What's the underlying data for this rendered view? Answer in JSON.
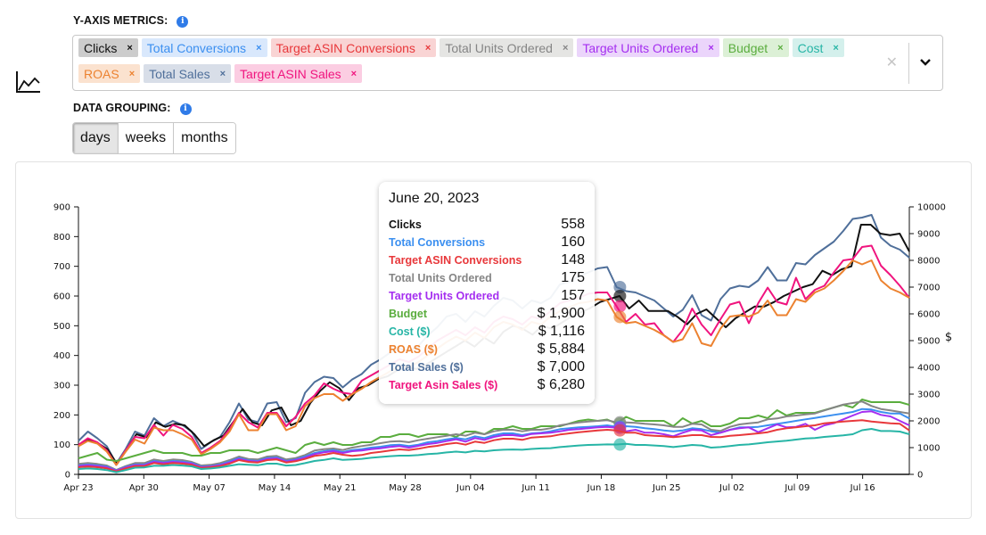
{
  "header": {
    "metrics_label": "Y-AXIS METRICS:",
    "grouping_label": "DATA GROUPING:",
    "info_icon": "i",
    "chart_type_icon": "line-chart-icon"
  },
  "metrics": [
    {
      "label": "Clicks",
      "color": "#111111",
      "bg": "#cccccc"
    },
    {
      "label": "Total Conversions",
      "color": "#3b8ff0",
      "bg": "#d9e8fc"
    },
    {
      "label": "Target ASIN Conversions",
      "color": "#e8383b",
      "bg": "#f9d4d4"
    },
    {
      "label": "Total Units Ordered",
      "color": "#858585",
      "bg": "#e5e5e3"
    },
    {
      "label": "Target Units Ordered",
      "color": "#a52ef0",
      "bg": "#ebd5fb"
    },
    {
      "label": "Budget",
      "color": "#5aad3e",
      "bg": "#dcf0d6"
    },
    {
      "label": "Cost",
      "color": "#27b5a6",
      "bg": "#d4f0ec"
    },
    {
      "label": "ROAS",
      "color": "#ec8230",
      "bg": "#fbe2cf"
    },
    {
      "label": "Total Sales",
      "color": "#4f6f9a",
      "bg": "#d8dee8"
    },
    {
      "label": "Target ASIN Sales",
      "color": "#f0147e",
      "bg": "#fbcde2"
    }
  ],
  "select": {
    "remove_glyph": "×",
    "clear_glyph": "✕"
  },
  "grouping": {
    "options": [
      "days",
      "weeks",
      "months"
    ],
    "selected": "days"
  },
  "tooltip": {
    "date": "June 20, 2023",
    "rows": [
      {
        "label": "Clicks",
        "value": "558",
        "color": "#111111"
      },
      {
        "label": "Total Conversions",
        "value": "160",
        "color": "#3b8ff0"
      },
      {
        "label": "Target ASIN Conversions",
        "value": "148",
        "color": "#e8383b"
      },
      {
        "label": "Total Units Ordered",
        "value": "175",
        "color": "#858585"
      },
      {
        "label": "Target Units Ordered",
        "value": "157",
        "color": "#a52ef0"
      },
      {
        "label": "Budget",
        "value": "$ 1,900",
        "color": "#5aad3e"
      },
      {
        "label": "Cost ($)",
        "value": "$ 1,116",
        "color": "#27b5a6"
      },
      {
        "label": "ROAS ($)",
        "value": "$ 5,884",
        "color": "#ec8230"
      },
      {
        "label": "Total Sales ($)",
        "value": "$ 7,000",
        "color": "#4f6f9a"
      },
      {
        "label": "Target Asin Sales ($)",
        "value": "$ 6,280",
        "color": "#f0147e"
      }
    ]
  },
  "chart_data": {
    "type": "line",
    "title": "",
    "xlabel": "",
    "ylabel_left": "",
    "ylabel_right": "$",
    "x_start": "2023-04-23",
    "x_end": "2023-07-21",
    "x_ticks": [
      "Apr 23",
      "Apr 30",
      "May 07",
      "May 14",
      "May 21",
      "May 28",
      "Jun 04",
      "Jun 11",
      "Jun 18",
      "Jun 25",
      "Jul 02",
      "Jul 09",
      "Jul 16"
    ],
    "ylim_left": [
      0,
      900
    ],
    "y_ticks_left": [
      0,
      100,
      200,
      300,
      400,
      500,
      600,
      700,
      800,
      900
    ],
    "ylim_right": [
      0,
      10000
    ],
    "y_ticks_right": [
      0,
      1000,
      2000,
      3000,
      4000,
      5000,
      6000,
      7000,
      8000,
      9000,
      10000
    ],
    "highlight_date": "2023-06-20",
    "grid": false,
    "series": [
      {
        "name": "Total Sales",
        "axis": "right",
        "color": "#4f6f9a",
        "values": [
          1250,
          1600,
          1350,
          1050,
          400,
          950,
          1600,
          1450,
          2100,
          1800,
          2000,
          1850,
          1600,
          950,
          1200,
          1400,
          1950,
          2650,
          2050,
          1950,
          2650,
          2700,
          1950,
          2100,
          3050,
          3450,
          3650,
          3600,
          3250,
          3550,
          3750,
          4100,
          4300,
          4550,
          4700,
          4600,
          4800,
          5200,
          5500,
          5900,
          6000,
          5700,
          6100,
          5900,
          6300,
          6600,
          6500,
          6200,
          6500,
          6400,
          6600,
          7100,
          7200,
          7400,
          7550,
          7700,
          7750,
          7000,
          6850,
          6800,
          6650,
          6500,
          6200,
          5900,
          6150,
          6700,
          5950,
          5750,
          6550,
          6950,
          7050,
          7000,
          7250,
          7750,
          7250,
          7250,
          7900,
          7850,
          8200,
          8450,
          8700,
          9100,
          9550,
          9600,
          9700,
          8850,
          8550,
          8400,
          8100
        ]
      },
      {
        "name": "Clicks",
        "axis": "left",
        "color": "#111111",
        "values": [
          100,
          115,
          105,
          85,
          35,
          85,
          135,
          125,
          175,
          160,
          170,
          165,
          135,
          95,
          115,
          130,
          175,
          220,
          175,
          165,
          215,
          225,
          165,
          180,
          240,
          280,
          310,
          290,
          250,
          290,
          300,
          320,
          330,
          350,
          360,
          355,
          370,
          390,
          410,
          430,
          450,
          430,
          460,
          440,
          480,
          500,
          490,
          470,
          500,
          490,
          510,
          530,
          545,
          560,
          580,
          590,
          600,
          558,
          585,
          550,
          550,
          550,
          530,
          505,
          540,
          555,
          525,
          495,
          525,
          545,
          565,
          565,
          580,
          600,
          615,
          630,
          640,
          685,
          670,
          690,
          700,
          840,
          840,
          810,
          805,
          810,
          750
        ]
      },
      {
        "name": "Target ASIN Sales",
        "axis": "right",
        "color": "#f0147e",
        "values": [
          1100,
          1350,
          1200,
          900,
          350,
          900,
          1400,
          1350,
          1850,
          1450,
          1850,
          1700,
          1400,
          800,
          1000,
          1250,
          1700,
          2300,
          1950,
          1750,
          2300,
          2300,
          1800,
          2150,
          2650,
          2950,
          3400,
          3200,
          3050,
          3000,
          3500,
          3700,
          3900,
          4100,
          4300,
          4200,
          4400,
          4700,
          5000,
          5200,
          5400,
          5200,
          5500,
          5300,
          5700,
          5900,
          5800,
          5600,
          5900,
          5800,
          6100,
          6400,
          6500,
          6600,
          6750,
          6800,
          6800,
          6280,
          5700,
          6000,
          5600,
          5650,
          5200,
          4950,
          5400,
          6200,
          5600,
          5200,
          5800,
          6350,
          6450,
          5650,
          6400,
          6980,
          6450,
          6350,
          7350,
          6550,
          6900,
          7050,
          7550,
          8000,
          8050,
          8500,
          8550,
          7800,
          7450,
          7050,
          6600
        ]
      },
      {
        "name": "ROAS",
        "axis": "right",
        "color": "#ec8230",
        "values": [
          1050,
          1250,
          1150,
          850,
          350,
          850,
          1300,
          1150,
          1750,
          1650,
          1650,
          1500,
          1300,
          750,
          950,
          1200,
          1600,
          2250,
          1650,
          1650,
          2250,
          2250,
          1650,
          1800,
          2550,
          2850,
          3000,
          3000,
          2750,
          3000,
          3200,
          3450,
          3650,
          3850,
          4050,
          4000,
          4200,
          4450,
          4700,
          4950,
          5150,
          5000,
          5300,
          5100,
          5500,
          5700,
          5600,
          5400,
          5700,
          5600,
          5900,
          6100,
          6250,
          6400,
          6450,
          6550,
          6500,
          5884,
          5650,
          5700,
          5550,
          5400,
          5200,
          4950,
          5050,
          5650,
          4900,
          4800,
          5450,
          5900,
          5950,
          5900,
          6050,
          6500,
          5950,
          5950,
          6550,
          6450,
          6800,
          6950,
          7250,
          7600,
          8000,
          7850,
          8000,
          7250,
          6950,
          6800,
          6600
        ]
      },
      {
        "name": "Budget",
        "axis": "right",
        "color": "#5aad3e",
        "values": [
          600,
          700,
          800,
          550,
          500,
          600,
          700,
          800,
          900,
          800,
          800,
          800,
          700,
          700,
          800,
          800,
          900,
          900,
          900,
          800,
          900,
          1000,
          900,
          800,
          1100,
          1200,
          1100,
          1200,
          1100,
          1100,
          1200,
          1200,
          1400,
          1400,
          1500,
          1500,
          1400,
          1500,
          1500,
          1500,
          1400,
          1600,
          1600,
          1500,
          1700,
          1700,
          1800,
          1700,
          1700,
          1800,
          1800,
          1800,
          1900,
          2000,
          2050,
          2000,
          2050,
          1900,
          2150,
          2000,
          2000,
          2000,
          2000,
          1800,
          2100,
          1900,
          2000,
          1800,
          1800,
          1900,
          2100,
          2100,
          2200,
          2100,
          2400,
          2200,
          2300,
          2300,
          2300,
          2400,
          2500,
          2600,
          2500,
          2800,
          2700,
          2700,
          2700,
          2700,
          2600
        ]
      },
      {
        "name": "Total Units Ordered",
        "axis": "left",
        "color": "#858585",
        "values": [
          35,
          38,
          35,
          30,
          15,
          28,
          38,
          38,
          50,
          45,
          50,
          48,
          42,
          30,
          32,
          38,
          48,
          60,
          52,
          50,
          60,
          62,
          50,
          55,
          65,
          80,
          85,
          87,
          82,
          90,
          95,
          100,
          105,
          110,
          112,
          108,
          115,
          120,
          125,
          130,
          135,
          130,
          140,
          135,
          145,
          150,
          150,
          145,
          150,
          150,
          155,
          165,
          170,
          175,
          178,
          180,
          182,
          175,
          175,
          173,
          170,
          168,
          165,
          160,
          160,
          170,
          168,
          150,
          146,
          160,
          168,
          172,
          175,
          185,
          188,
          195,
          198,
          202,
          205,
          215,
          225,
          235,
          240,
          245,
          230,
          220,
          215,
          210,
          205
        ]
      },
      {
        "name": "Total Conversions",
        "axis": "left",
        "color": "#3b8ff0",
        "values": [
          30,
          33,
          30,
          26,
          13,
          25,
          33,
          33,
          45,
          40,
          45,
          43,
          38,
          26,
          28,
          33,
          43,
          55,
          47,
          45,
          55,
          57,
          45,
          50,
          60,
          72,
          78,
          82,
          75,
          82,
          85,
          90,
          93,
          98,
          100,
          95,
          100,
          108,
          112,
          118,
          122,
          118,
          128,
          122,
          132,
          138,
          138,
          132,
          138,
          140,
          145,
          152,
          155,
          158,
          160,
          162,
          165,
          160,
          162,
          160,
          155,
          152,
          148,
          145,
          148,
          155,
          152,
          145,
          140,
          150,
          158,
          158,
          160,
          165,
          170,
          175,
          180,
          185,
          190,
          195,
          200,
          205,
          210,
          220,
          218,
          210,
          205,
          205,
          188
        ]
      },
      {
        "name": "Target Units Ordered",
        "axis": "left",
        "color": "#a52ef0",
        "values": [
          28,
          31,
          28,
          24,
          12,
          23,
          31,
          31,
          42,
          38,
          42,
          40,
          36,
          24,
          26,
          31,
          40,
          52,
          45,
          43,
          52,
          54,
          43,
          48,
          56,
          68,
          74,
          78,
          72,
          78,
          80,
          85,
          88,
          92,
          95,
          90,
          96,
          102,
          106,
          112,
          118,
          110,
          122,
          116,
          126,
          132,
          132,
          128,
          136,
          138,
          140,
          145,
          150,
          152,
          155,
          158,
          160,
          157,
          145,
          150,
          140,
          140,
          135,
          128,
          140,
          150,
          148,
          132,
          140,
          150,
          155,
          158,
          142,
          155,
          168,
          158,
          160,
          170,
          150,
          165,
          172,
          185,
          198,
          210,
          212,
          200,
          195,
          180,
          165
        ]
      },
      {
        "name": "Target ASIN Conversions",
        "axis": "left",
        "color": "#e8383b",
        "values": [
          24,
          26,
          24,
          20,
          10,
          20,
          28,
          28,
          38,
          34,
          38,
          36,
          32,
          22,
          24,
          28,
          36,
          48,
          42,
          40,
          48,
          50,
          40,
          44,
          52,
          62,
          66,
          72,
          66,
          62,
          65,
          72,
          76,
          80,
          84,
          82,
          86,
          92,
          96,
          102,
          106,
          100,
          110,
          106,
          115,
          120,
          120,
          116,
          124,
          126,
          128,
          134,
          138,
          142,
          145,
          148,
          150,
          148,
          140,
          140,
          132,
          130,
          128,
          125,
          128,
          132,
          132,
          126,
          125,
          130,
          132,
          135,
          138,
          142,
          150,
          155,
          158,
          162,
          165,
          172,
          175,
          178,
          180,
          182,
          178,
          175,
          172,
          170,
          148
        ]
      },
      {
        "name": "Cost",
        "axis": "right",
        "color": "#27b5a6",
        "values": [
          200,
          220,
          200,
          160,
          80,
          160,
          250,
          260,
          320,
          320,
          350,
          330,
          300,
          200,
          220,
          260,
          320,
          380,
          360,
          340,
          400,
          400,
          330,
          350,
          420,
          500,
          540,
          600,
          540,
          560,
          580,
          620,
          650,
          680,
          700,
          700,
          720,
          760,
          780,
          820,
          850,
          820,
          880,
          860,
          900,
          920,
          930,
          920,
          950,
          970,
          980,
          1020,
          1050,
          1080,
          1100,
          1110,
          1120,
          1116,
          1140,
          1100,
          1100,
          1080,
          1060,
          1020,
          1060,
          1100,
          1080,
          1000,
          1020,
          1060,
          1100,
          1120,
          1160,
          1200,
          1230,
          1260,
          1300,
          1340,
          1360,
          1400,
          1430,
          1460,
          1500,
          1650,
          1700,
          1620,
          1620,
          1600,
          1500
        ]
      }
    ]
  }
}
